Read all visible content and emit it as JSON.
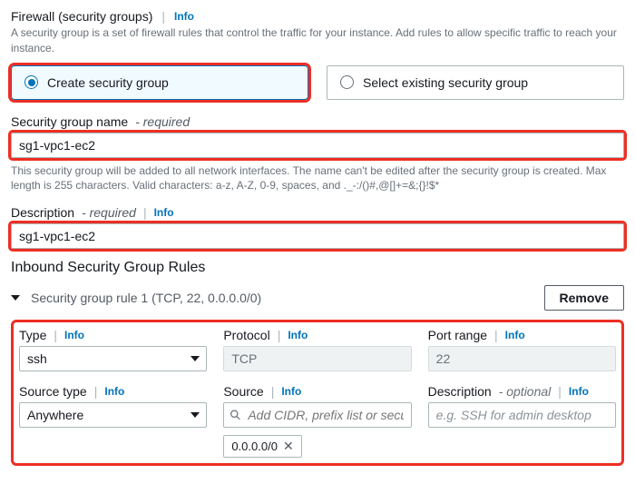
{
  "info_label": "Info",
  "firewall": {
    "title": "Firewall (security groups)",
    "help": "A security group is a set of firewall rules that control the traffic for your instance. Add rules to allow specific traffic to reach your instance."
  },
  "radios": {
    "create": "Create security group",
    "select": "Select existing security group"
  },
  "sg_name": {
    "label": "Security group name",
    "required": "- required",
    "value": "sg1-vpc1-ec2",
    "constraint": "This security group will be added to all network interfaces. The name can't be edited after the security group is created. Max length is 255 characters. Valid characters: a-z, A-Z, 0-9, spaces, and ._-:/()#,@[]+=&;{}!$*"
  },
  "sg_desc": {
    "label": "Description",
    "required": "- required",
    "value": "sg1-vpc1-ec2"
  },
  "inbound": {
    "title": "Inbound Security Group Rules",
    "rule_summary": "Security group rule 1 (TCP, 22, 0.0.0.0/0)",
    "remove": "Remove"
  },
  "rule": {
    "type_label": "Type",
    "type_value": "ssh",
    "protocol_label": "Protocol",
    "protocol_value": "TCP",
    "port_label": "Port range",
    "port_value": "22",
    "source_type_label": "Source type",
    "source_type_value": "Anywhere",
    "source_label": "Source",
    "source_placeholder": "Add CIDR, prefix list or security",
    "source_token": "0.0.0.0/0",
    "desc_label": "Description",
    "desc_optional": "- optional",
    "desc_placeholder": "e.g. SSH for admin desktop"
  }
}
